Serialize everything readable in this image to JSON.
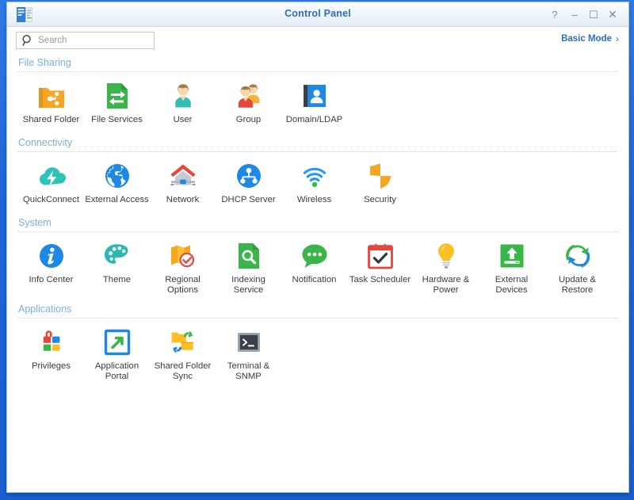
{
  "window": {
    "title": "Control Panel",
    "app_icon": "control-panel-icon",
    "buttons": {
      "help": "?",
      "minimize": "–",
      "maximize": "☐",
      "close": "✕"
    }
  },
  "toolbar": {
    "search": {
      "placeholder": "Search",
      "value": "",
      "icon": "search-icon"
    },
    "mode": {
      "label": "Basic Mode",
      "chevron": "›"
    }
  },
  "accent_colors": {
    "window_frame_blue": "#1f66d8",
    "title_text_blue": "#2a6fc4",
    "section_header_blue": "#79b0de",
    "label_gray": "#3c3c3c"
  },
  "sections": [
    {
      "title": "File Sharing",
      "items": [
        {
          "label": "Shared Folder",
          "icon": "shared-folder-icon"
        },
        {
          "label": "File Services",
          "icon": "file-services-icon"
        },
        {
          "label": "User",
          "icon": "user-icon"
        },
        {
          "label": "Group",
          "icon": "group-icon"
        },
        {
          "label": "Domain/LDAP",
          "icon": "domain-ldap-icon"
        }
      ]
    },
    {
      "title": "Connectivity",
      "items": [
        {
          "label": "QuickConnect",
          "icon": "quickconnect-icon"
        },
        {
          "label": "External Access",
          "icon": "external-access-icon"
        },
        {
          "label": "Network",
          "icon": "network-icon"
        },
        {
          "label": "DHCP Server",
          "icon": "dhcp-server-icon"
        },
        {
          "label": "Wireless",
          "icon": "wireless-icon"
        },
        {
          "label": "Security",
          "icon": "security-icon"
        }
      ]
    },
    {
      "title": "System",
      "items": [
        {
          "label": "Info Center",
          "icon": "info-center-icon"
        },
        {
          "label": "Theme",
          "icon": "theme-icon"
        },
        {
          "label": "Regional Options",
          "icon": "regional-options-icon"
        },
        {
          "label": "Indexing Service",
          "icon": "indexing-service-icon"
        },
        {
          "label": "Notification",
          "icon": "notification-icon"
        },
        {
          "label": "Task Scheduler",
          "icon": "task-scheduler-icon"
        },
        {
          "label": "Hardware & Power",
          "icon": "hardware-power-icon"
        },
        {
          "label": "External Devices",
          "icon": "external-devices-icon"
        },
        {
          "label": "Update & Restore",
          "icon": "update-restore-icon"
        }
      ]
    },
    {
      "title": "Applications",
      "items": [
        {
          "label": "Privileges",
          "icon": "privileges-icon"
        },
        {
          "label": "Application Portal",
          "icon": "application-portal-icon"
        },
        {
          "label": "Shared Folder Sync",
          "icon": "shared-folder-sync-icon"
        },
        {
          "label": "Terminal & SNMP",
          "icon": "terminal-snmp-icon"
        }
      ]
    }
  ]
}
